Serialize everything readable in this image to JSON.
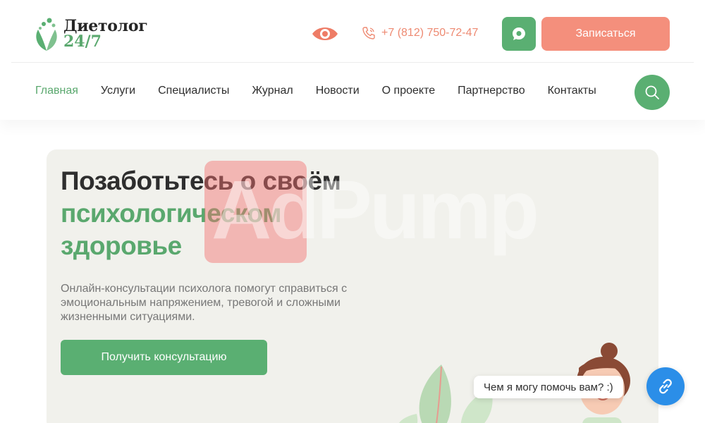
{
  "logo": {
    "title": "Диетолог",
    "subtitle": "24/7"
  },
  "header": {
    "phone": "+7 (812) 750-72-47",
    "signup_label": "Записаться",
    "accessibility_icon": "eye-icon",
    "chat_icon": "chat-icon"
  },
  "nav": {
    "items": [
      {
        "label": "Главная",
        "active": true
      },
      {
        "label": "Услуги"
      },
      {
        "label": "Специалисты"
      },
      {
        "label": "Журнал"
      },
      {
        "label": "Новости"
      },
      {
        "label": "О проекте"
      },
      {
        "label": "Партнерство"
      },
      {
        "label": "Контакты"
      }
    ],
    "search_icon": "search-icon"
  },
  "hero": {
    "title_line1": "Позаботьтесь о своём",
    "title_line2": "психологическом",
    "title_line3": "здоровье",
    "description": "Онлайн-консультации психолога помогут справиться с эмоциональным напряжением, тревогой и сложными жизненными ситуациями.",
    "cta_label": "Получить консультацию"
  },
  "watermark": {
    "text": "AdPump"
  },
  "chat_widget": {
    "bubble_text": "Чем я могу помочь вам? :)",
    "icon": "link-icon"
  },
  "colors": {
    "green": "#5aaf72",
    "coral": "#f48f7c",
    "blue": "#2b8ee8",
    "hero_bg": "#f1f1ec"
  }
}
